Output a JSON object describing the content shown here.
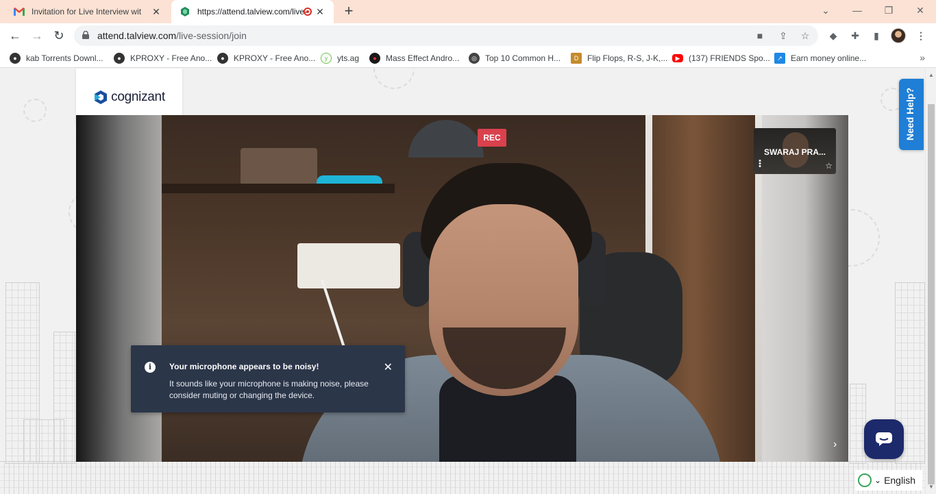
{
  "browser": {
    "tabs": [
      {
        "title": "Invitation for Live Interview with C",
        "favicon": "gmail-icon"
      },
      {
        "title": "https://attend.talview.com/live-session/join",
        "favicon": "talview-icon",
        "recording": true
      }
    ],
    "url_host": "attend.talview.com",
    "url_path": "/live-session/join",
    "bookmarks": [
      {
        "label": "kab Torrents Downl...",
        "icon": "torrent-icon",
        "color": "#333333"
      },
      {
        "label": "KPROXY - Free Ano...",
        "icon": "kproxy-icon",
        "color": "#333333"
      },
      {
        "label": "KPROXY - Free Ano...",
        "icon": "kproxy-icon",
        "color": "#333333"
      },
      {
        "label": "yts.ag",
        "icon": "yts-icon",
        "color": "#6ac045"
      },
      {
        "label": "Mass Effect Andro...",
        "icon": "mass-effect-icon",
        "color": "#b32d2d"
      },
      {
        "label": "Top 10 Common H...",
        "icon": "globe-icon",
        "color": "#444444"
      },
      {
        "label": "Flip Flops, R-S, J-K,...",
        "icon": "site-icon",
        "color": "#c58b2c"
      },
      {
        "label": "(137) FRIENDS Spo...",
        "icon": "youtube-icon",
        "color": "#ff0000"
      },
      {
        "label": "Earn money online...",
        "icon": "arrow-icon",
        "color": "#1e88e5"
      }
    ]
  },
  "page": {
    "logo_text": "cognizant",
    "rec_label": "REC",
    "self_view_name": "SWARAJ PRA...",
    "toast": {
      "title": "Your microphone appears to be noisy!",
      "body": "It sounds like your microphone is making noise, please consider muting or changing the device."
    },
    "need_help_label": "Need Help?",
    "language_label": "English",
    "colors": {
      "tab_bar": "#fbe2d4",
      "rec": "#d9414d",
      "toast_bg": "#2b3649",
      "need_help": "#1f7ed6",
      "chat": "#1c2a6b"
    }
  }
}
